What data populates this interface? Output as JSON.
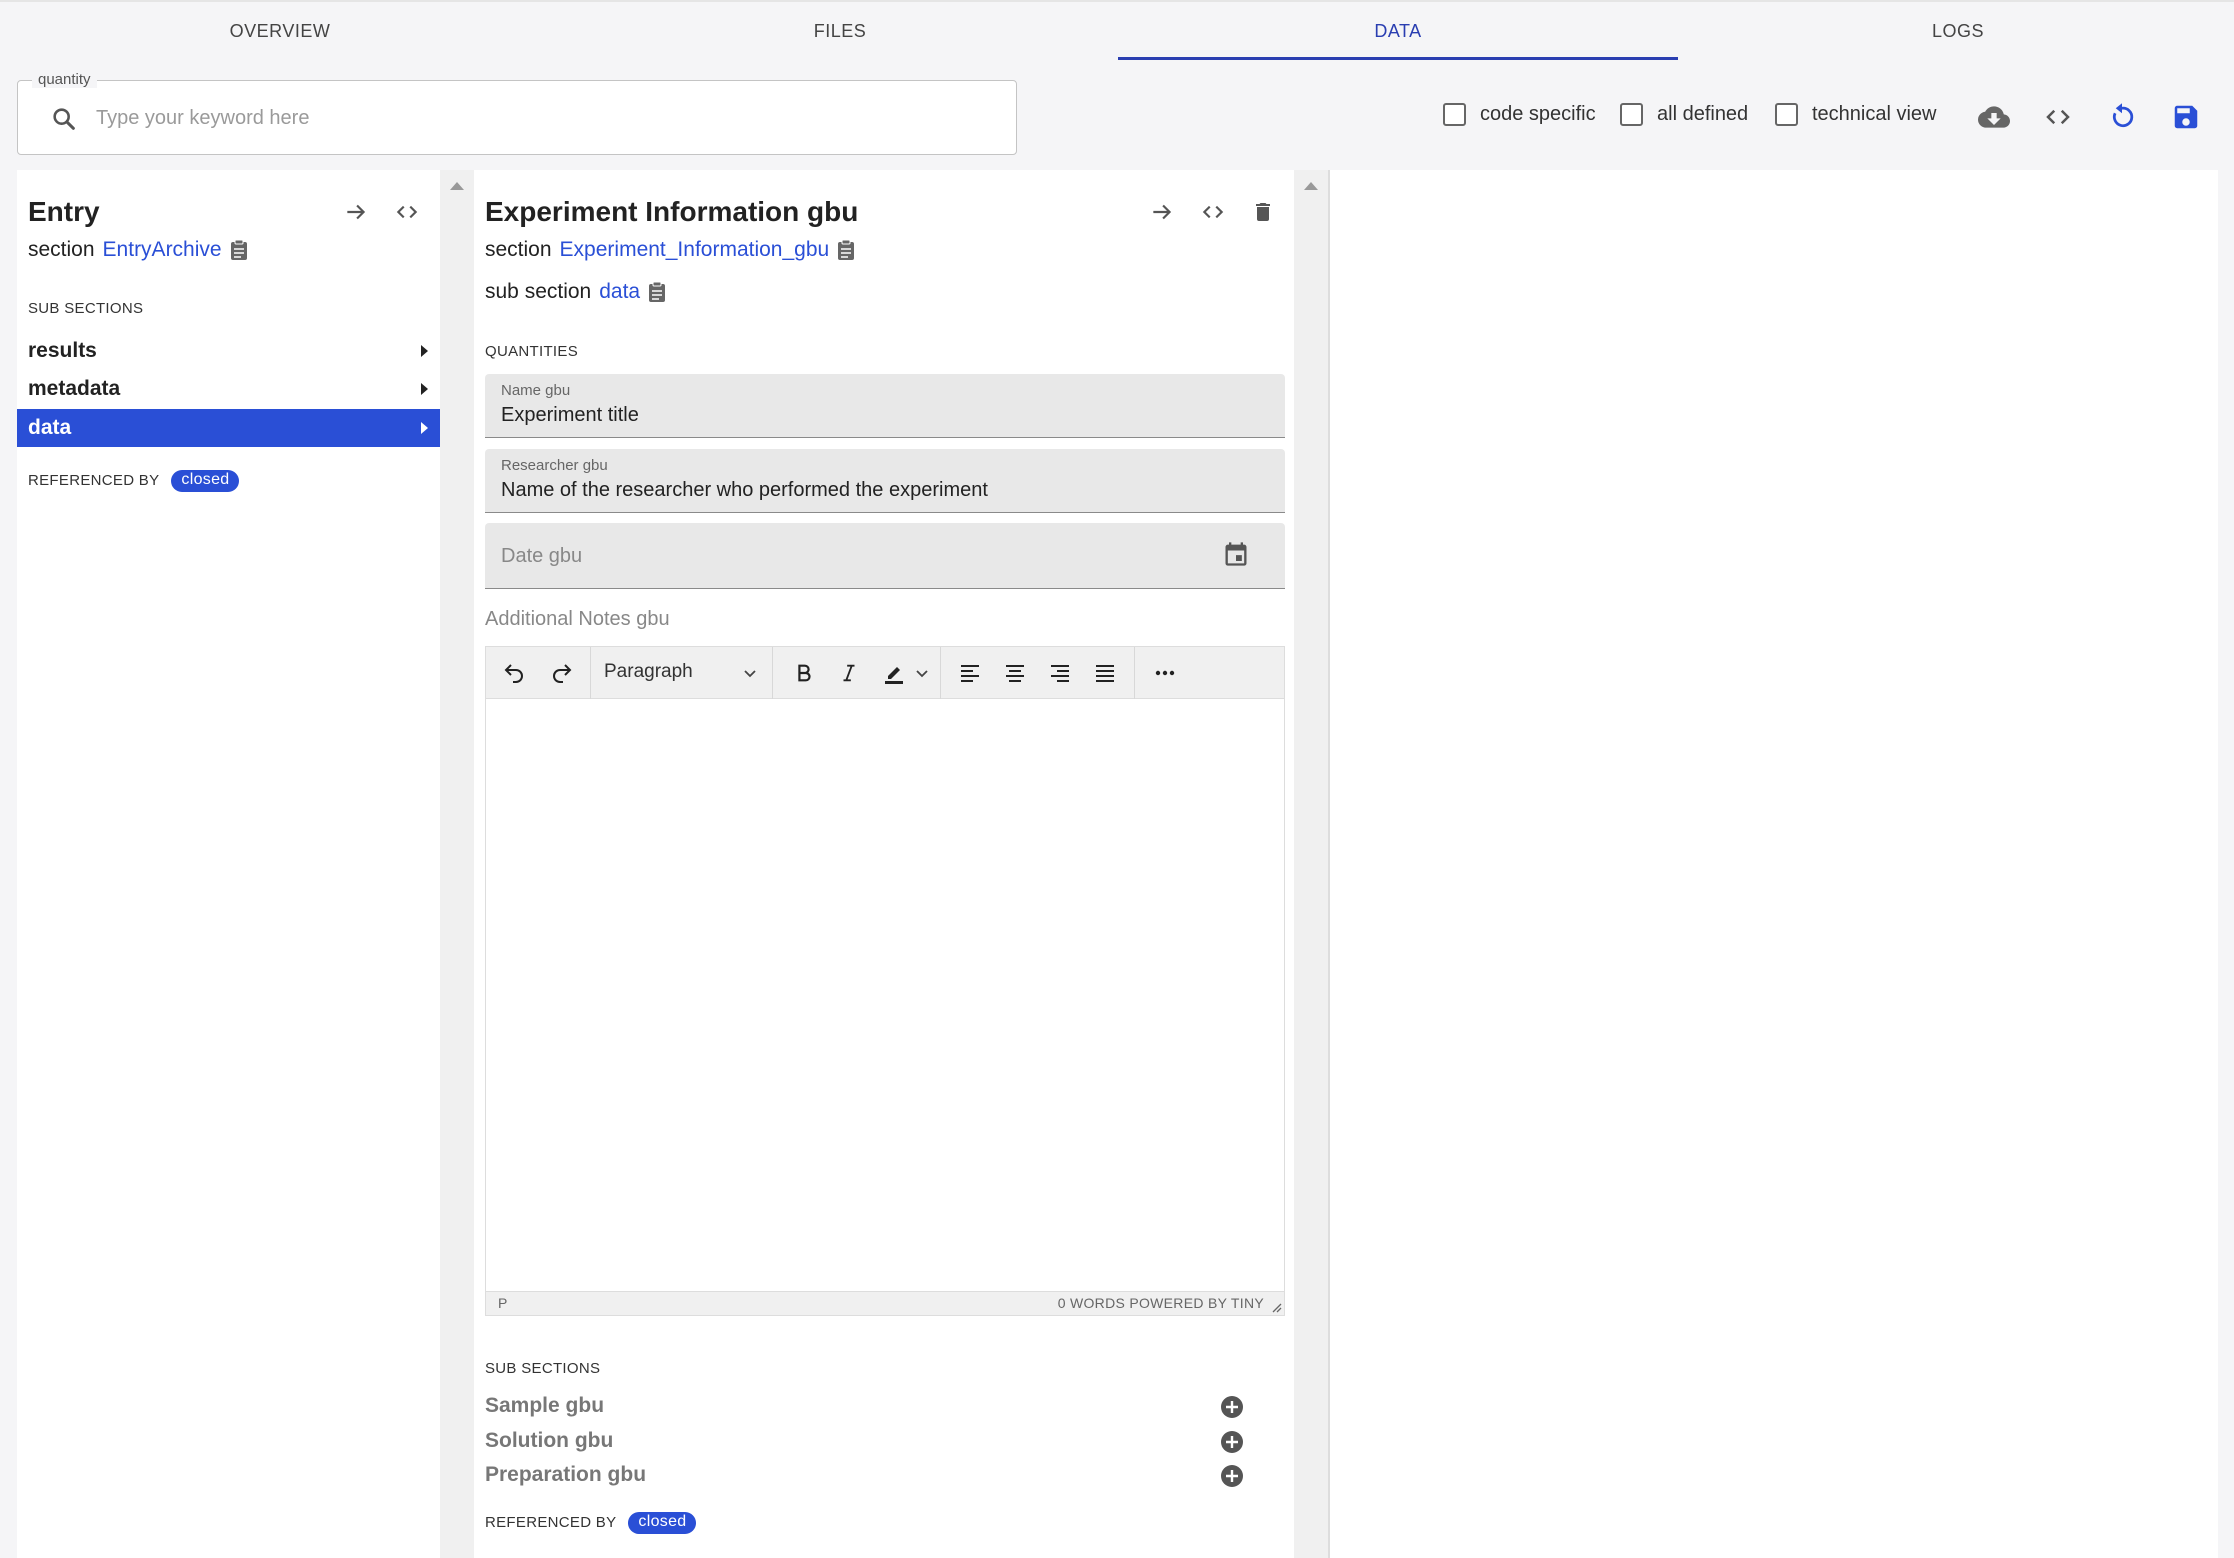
{
  "tabs": [
    {
      "label": "OVERVIEW",
      "active": false
    },
    {
      "label": "FILES",
      "active": false
    },
    {
      "label": "DATA",
      "active": true
    },
    {
      "label": "LOGS",
      "active": false
    }
  ],
  "search": {
    "legend": "quantity",
    "placeholder": "Type your keyword here",
    "value": "",
    "icon": "search-icon"
  },
  "options": {
    "code_specific": "code specific",
    "all_defined": "all defined",
    "technical_view": "technical view"
  },
  "toolbar_icons": [
    "cloud-download-icon",
    "code-icon",
    "reload-icon",
    "save-icon"
  ],
  "colors": {
    "accent": "#2a4fd6",
    "tab_active": "#2a3eb1",
    "save": "#2a4fd6"
  },
  "entry_panel": {
    "title": "Entry",
    "section_label": "section",
    "section_link": "EntryArchive",
    "sub_sections_heading": "SUB SECTIONS",
    "items": [
      {
        "label": "results",
        "selected": false
      },
      {
        "label": "metadata",
        "selected": false
      },
      {
        "label": "data",
        "selected": true
      }
    ],
    "referenced_by": "REFERENCED BY",
    "badge": "closed"
  },
  "experiment_panel": {
    "title": "Experiment Information gbu",
    "section_label": "section",
    "section_link": "Experiment_Information_gbu",
    "sub_section_label": "sub section",
    "sub_section_link": "data",
    "quantities_heading": "QUANTITIES",
    "fields": {
      "name": {
        "label": "Name gbu",
        "value": "Experiment title"
      },
      "researcher": {
        "label": "Researcher gbu",
        "value": "Name of the researcher who performed the experiment"
      },
      "date": {
        "placeholder": "Date gbu"
      }
    },
    "notes_label": "Additional Notes gbu",
    "editor": {
      "block_format": "Paragraph",
      "status_path": "P",
      "status_right": "0 WORDS  POWERED BY TINY"
    },
    "sub_sections_heading": "SUB SECTIONS",
    "sub_sections": [
      {
        "label": "Sample gbu"
      },
      {
        "label": "Solution gbu"
      },
      {
        "label": "Preparation gbu"
      }
    ],
    "referenced_by": "REFERENCED BY",
    "badge": "closed"
  }
}
